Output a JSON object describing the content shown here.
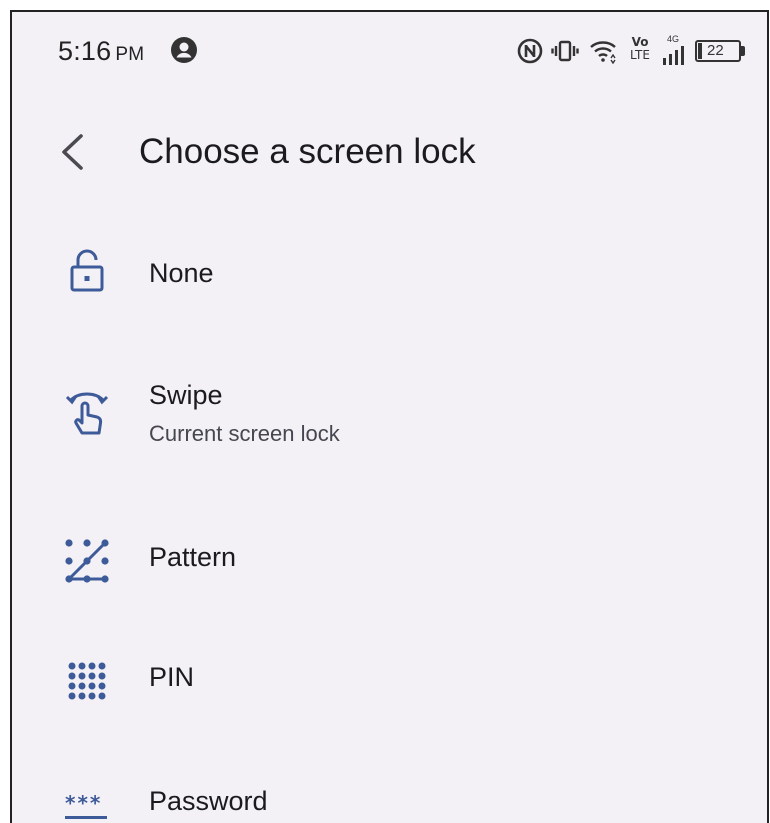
{
  "status_bar": {
    "time": "5:16",
    "ampm": "PM",
    "volte_top": "Vo",
    "volte_bottom": "LTE",
    "network_type": "4G",
    "battery_level": "22",
    "icons": [
      "account-circle-icon",
      "nfc-icon",
      "vibrate-icon",
      "wifi-icon",
      "volte-icon",
      "signal-icon",
      "battery-icon"
    ]
  },
  "header": {
    "back_icon": "chevron-left-icon",
    "title": "Choose a screen lock"
  },
  "options": [
    {
      "icon": "unlocked-padlock-icon",
      "label": "None",
      "sublabel": ""
    },
    {
      "icon": "swipe-hand-icon",
      "label": "Swipe",
      "sublabel": "Current screen lock"
    },
    {
      "icon": "pattern-dots-icon",
      "label": "Pattern",
      "sublabel": ""
    },
    {
      "icon": "pin-keypad-icon",
      "label": "PIN",
      "sublabel": ""
    },
    {
      "icon": "password-asterisks-icon",
      "label": "Password",
      "sublabel": ""
    }
  ],
  "colors": {
    "background": "#f3f1f6",
    "icon_accent": "#3d5a99",
    "text_primary": "#1b1b1f",
    "text_secondary": "#45464f"
  }
}
